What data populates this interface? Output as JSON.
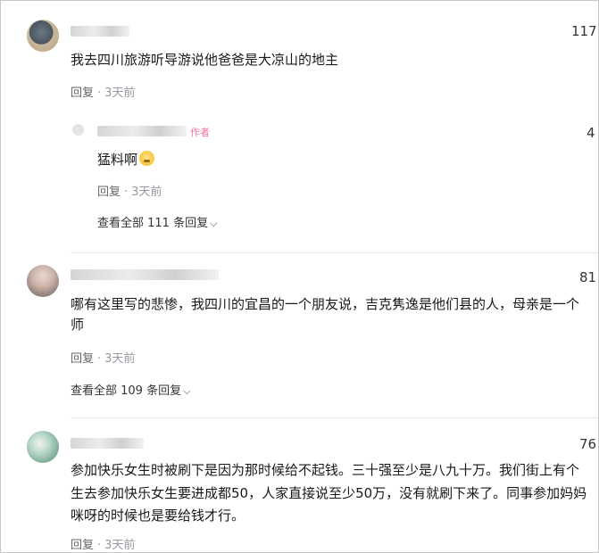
{
  "comments": [
    {
      "likes": "117",
      "text": "我去四川旅游听导游说他爸爸是大凉山的地主",
      "reply_label": "回复",
      "time": "3天前",
      "reply": {
        "up_tag": "作者",
        "likes": "4",
        "text": "猛料啊",
        "emoji": "smirk-emoji",
        "reply_label": "回复",
        "time": "3天前"
      },
      "view_all": "查看全部 111 条回复"
    },
    {
      "likes": "81",
      "text_line1": "哪有这里写的悲惨，我四川的宜昌的一个朋友说，吉克隽逸是他们县的人，母亲是一个",
      "text_line2": "师",
      "reply_label": "回复",
      "time": "3天前",
      "view_all": "查看全部 109 条回复"
    },
    {
      "likes": "76",
      "text_line1": "参加快乐女生时被刷下是因为那时候给不起钱。三十强至少是八九十万。我们街上有个",
      "text_line2": "生去参加快乐女生要进成都50，人家直接说至少50万，没有就刷下来了。同事参加妈妈",
      "text_line3": "咪呀的时候也是要给钱才行。",
      "reply_label": "回复",
      "time": "3天前"
    }
  ],
  "colors": {
    "up_tag": "#fb7299",
    "meta": "#9499a0",
    "text": "#18191c"
  }
}
